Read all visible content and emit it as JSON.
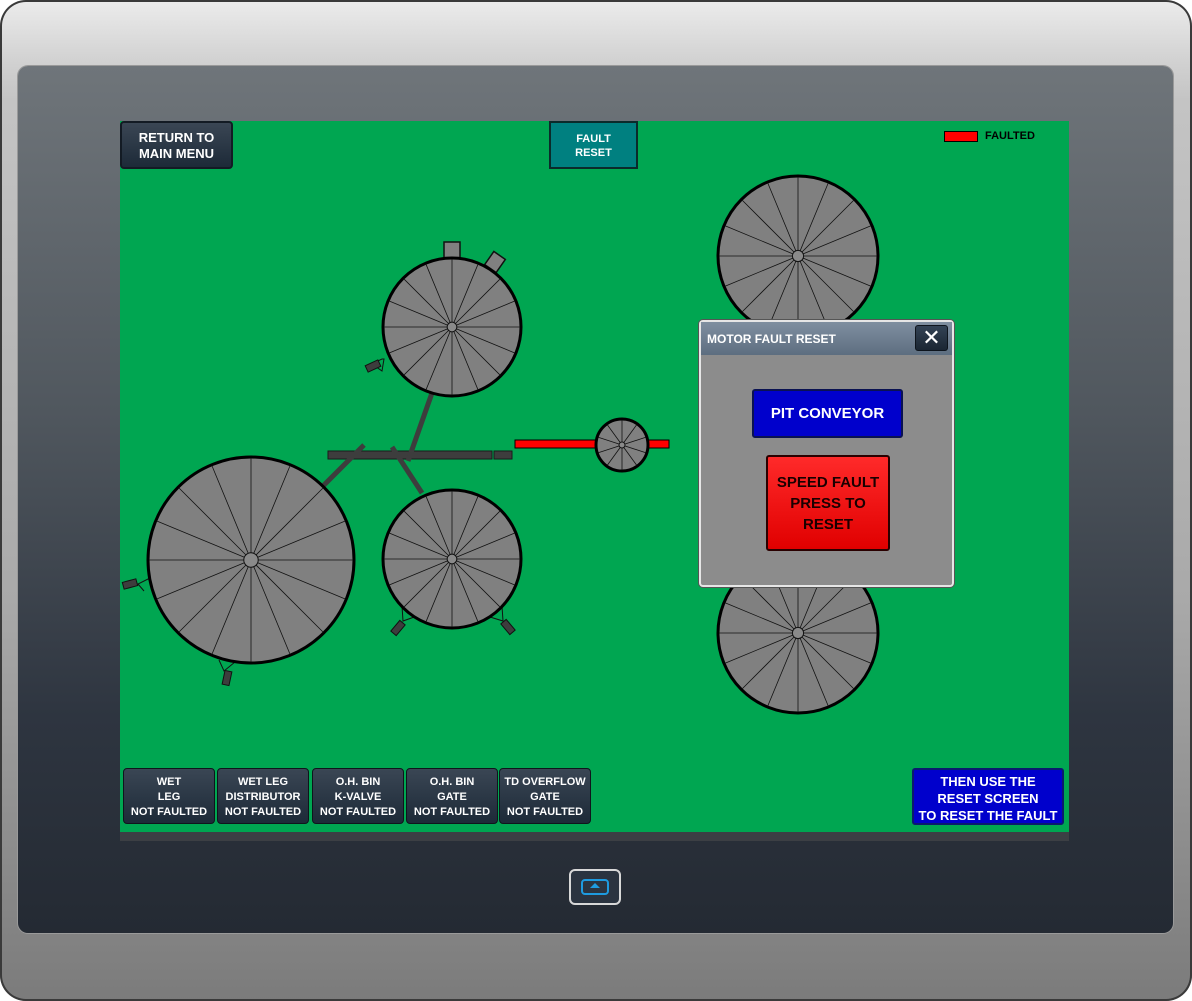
{
  "screen": {
    "return_button": {
      "line1": "RETURN TO",
      "line2": "MAIN MENU"
    },
    "fault_reset_button": {
      "line1": "FAULT",
      "line2": "RESET"
    },
    "legend": {
      "label": "FAULTED",
      "color": "#ff0000"
    },
    "background_color": "#00a651",
    "status_buttons": [
      {
        "line1": "WET",
        "line2": "LEG",
        "line3": "NOT FAULTED"
      },
      {
        "line1": "WET LEG",
        "line2": "DISTRIBUTOR",
        "line3": "NOT FAULTED"
      },
      {
        "line1": "O.H. BIN",
        "line2": "K-VALVE",
        "line3": "NOT FAULTED"
      },
      {
        "line1": "O.H. BIN",
        "line2": "GATE",
        "line3": "NOT FAULTED"
      },
      {
        "line1": "TD OVERFLOW",
        "line2": "GATE",
        "line3": "NOT FAULTED"
      }
    ],
    "instruction": {
      "line1": "THEN USE THE",
      "line2": "RESET SCREEN",
      "line3": "TO RESET THE FAULT"
    }
  },
  "popup": {
    "title": "MOTOR FAULT RESET",
    "close_glyph": "✕",
    "device_button": "PIT CONVEYOR",
    "fault_button": {
      "line1": "SPEED FAULT",
      "line2": "PRESS TO",
      "line3": "RESET"
    },
    "fault_color": "#ff0000",
    "device_color": "#0000cc"
  },
  "device": {
    "home_button_icon": "eject-icon"
  }
}
